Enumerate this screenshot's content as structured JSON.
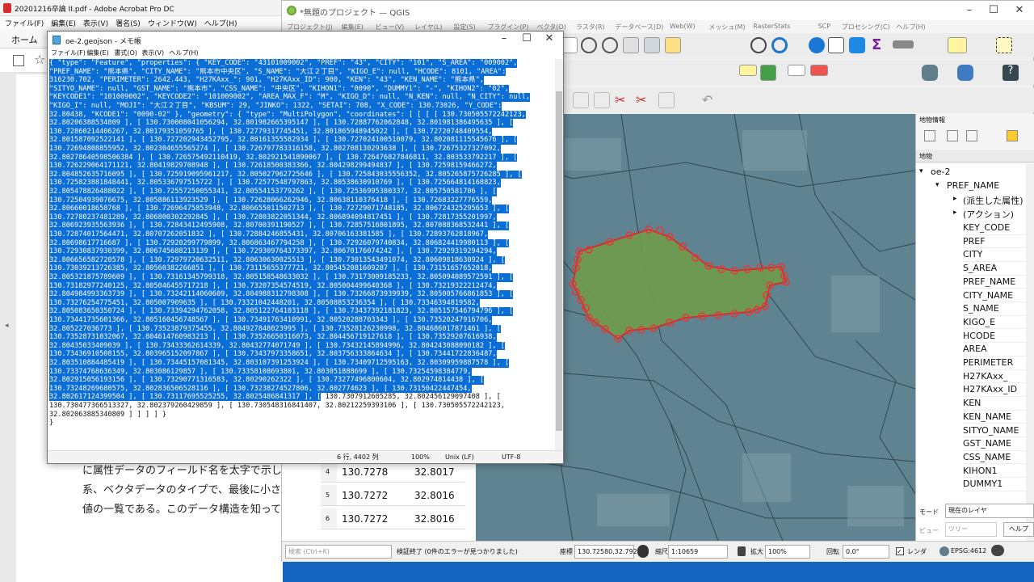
{
  "acrobat": {
    "title": "20201216卒論 II.pdf - Adobe Acrobat Pro DC",
    "menu": "ファイル(F)　編集(E)　表示(V)　署名(S)　ウィンドウ(W)　ヘルプ(H)",
    "home_tab": "ホーム",
    "text_lines": [
      "に属性データのフィールド名を太字で示した。",
      "系、ベクタデータのタイプで、最後に小さい字",
      "値の一覧である。このデータ構造を知っていれ"
    ]
  },
  "qgis": {
    "title": "*無題のプロジェクト — QGIS",
    "menu": [
      "プロジェクト(J)",
      "編集(E)",
      "ビュー(V)",
      "レイヤ(L)",
      "設定(S)",
      "プラグイン(P)",
      "ベクタ(O)",
      "ラスタ(R)",
      "データベース(D)",
      "Web(W)",
      "メッシュ(M)",
      "RasterStats",
      "SCP",
      "プロセシング(C)",
      "ヘルプ(H)"
    ],
    "identify": {
      "title": "地物情報",
      "layer_header": "地物",
      "layer": "oe-2",
      "field": "PREF_NAME",
      "derived": "(派生した属性)",
      "action": "(アクション)",
      "fields": [
        "KEY_CODE",
        "PREF",
        "CITY",
        "S_AREA",
        "PREF_NAME",
        "CITY_NAME",
        "S_NAME",
        "KIGO_E",
        "HCODE",
        "AREA",
        "PERIMETER",
        "H27KAxx_",
        "H27KAxx_ID",
        "KEN",
        "KEN_NAME",
        "SITYO_NAME",
        "GST_NAME",
        "CSS_NAME",
        "KIHON1",
        "DUMMY1"
      ],
      "mode_label": "モード",
      "mode_value": "現在のレイヤ",
      "view_label": "ビュー",
      "view_value": "ツリー",
      "help": "ヘルプ"
    },
    "status": {
      "search_placeholder": "検索 (Ctrl+K)",
      "message": "検証終了 (0件のエラーが見つかりました)",
      "coord_label": "座標",
      "coord": "130.72580,32.79299",
      "scale_label": "縮尺",
      "scale": "1:10659",
      "zoom_label": "拡大",
      "zoom": "100%",
      "rotation_label": "回転",
      "rotation": "0.0°",
      "render": "レンダ",
      "crs": "EPSG:4612"
    },
    "attr_rows": [
      {
        "n": "4",
        "x": "130.7278",
        "y": "32.8017"
      },
      {
        "n": "5",
        "x": "130.7272",
        "y": "32.8016"
      },
      {
        "n": "6",
        "x": "130.7272",
        "y": "32.8016"
      }
    ]
  },
  "notepad": {
    "title": "oe-2.geojson - メモ帳",
    "menu": [
      "ファイル(F)",
      "編集(E)",
      "書式(O)",
      "表示(V)",
      "ヘルプ(H)"
    ],
    "lines": [
      "{ \"type\": \"Feature\", \"properties\": { \"KEY_CODE\": \"43101009002\", \"PREF\": \"43\", \"CITY\": \"101\", \"S_AREA\": \"009002\",",
      "\"PREF_NAME\": \"熊本県\", \"CITY_NAME\": \"熊本市中央区\", \"S_NAME\": \"大江２丁目\", \"KIGO_E\": null, \"HCODE\": 8101, \"AREA\":",
      "316230.702, \"PERIMETER\": 2642.443, \"H27KAxx_\": 901, \"H27KAxx_ID\": 900, \"KEN\": \"43\", \"KEN_NAME\": \"熊本県\",",
      "\"SITYO_NAME\": null, \"GST_NAME\": \"熊本市\", \"CSS_NAME\": \"中央区\", \"KIHON1\": \"0090\", \"DUMMY1\": \"-\", \"KIHON2\": \"02\",",
      "\"KEYCODE1\": \"101009002\", \"KEYCODE2\": \"101009002\", \"AREA_MAX_F\": \"M\", \"KIGO_D\": null, \"N_KEN\": null, \"N_CITY\": null,",
      "\"KIGO_I\": null, \"MOJI\": \"大江２丁目\", \"KBSUM\": 29, \"JINKO\": 1322, \"SETAI\": 708, \"X_CODE\": 130.73026, \"Y_CODE\":",
      "32.80438, \"KCODE1\": \"0090-02\" }, \"geometry\": { \"type\": \"MultiPolygon\", \"coordinates\": [ [ [ [ 130.730505572242123,",
      "32.80206388534809 ], [ 130.730008041056294, 32.801982665395147 ], [ 130.72887762062848, 32.801981386495635 ], [",
      "130.72860214406267, 32.80179351059765 ], [ 130.72779317745451, 32.801865948945022 ], [ 130.72720748409554,",
      "32.801587092522141 ], [ 130.727202943452795, 32.80161355582934 ], [ 130.727024100510079, 32.802081115545676 ], [",
      "130.72694808855952, 32.802304655565274 ], [ 130.726797783316158, 32.802708130293638 ], [ 130.72675327327092,",
      "32.80278640598506384 ], [ 130.726575492110419, 32.802921541890067 ], [ 130.726476827846811, 32.803533792217 ], [",
      "130.726229064171121, 32.80419829708948 ], [ 130.72618500383366, 32.804298299494837 ], [ 130.72598159466272,",
      "32.804852635716095 ], [ 130.725919095961217, 32.805027962725646 ], [ 130.725843035556352, 32.805265875726285 ], [",
      "130.725823881848441, 32.805336797515722 ], [ 130.72577548797863, 32.80538630910769 ], [ 130.725664814168823,",
      "32.805478826488022 ], [ 130.72557250055341, 32.80554153779262 ], [ 130.72536995380337, 32.805750581706 ], [",
      "130.72504939076675, 32.805886113923529 ], [ 130.72628066262946, 32.80638110376418 ], [ 130.72683227776559,",
      "32.80660018658768 ], [ 130.72696475853948, 32.806655011502713 ], [ 130.72729071748185, 32.806724325295653 ], [",
      "130.72780237481289, 32.806800302292845 ], [ 130.72803822051344, 32.806894094817451 ], [ 130.72817355201997,",
      "32.806923935563936 ], [ 130.72843412495908, 32.80700391190527 ], [ 130.72857516801895, 32.807088368532441 ], [",
      "130.72874017564471, 32.80707262051832 ], [ 130.72884246855431, 32.80706163381585 ], [ 130.72893762818967,",
      "32.80698617716687 ], [ 130.72920299779899, 32.806863467794258 ], [ 130.72926079740834, 32.806824419980113 ], [",
      "130.72930837930399, 32.806745688213139 ], [ 130.729309764373397, 32.80670176074242 ], [ 130.72929319294294,",
      "32.806656582720578 ], [ 130.72979720632511, 32.80630630025513 ], [ 130.73013543491074, 32.80609818630924 ], [",
      "130.73039213726385, 32.80560382266851 ], [ 130.73115655377721, 32.805452081609287 ], [ 130.73151657652018,",
      "32.805321875789609 ], [ 130.73161345799318, 32.805158548633032 ], [ 130.73173009185233, 32.805094089572591 ], [",
      "130.73182977240125, 32.805046455717218 ], [ 130.73207354574519, 32.805004499640368 ], [ 130.73219322212474,",
      "32.804984993363739 ], [ 130.73242114060609, 32.804988312798308 ], [ 130.73266873939939, 32.805005766861853 ], [",
      "130.73276254775451, 32.805007909635 ], [ 130.73321042448201, 32.80508853236354 ], [ 130.73346394819582,",
      "32.805083650350724 ], [ 130.73394294762058, 32.805122764103118 ], [ 130.73437392181823, 32.805157546794796 ], [",
      "130.73441735601366, 32.805160456748567 ], [ 130.73491763410991, 32.80520288703343 ], [ 130.73520247916706,",
      "32.805227036773 ], [ 130.73523879375455, 32.804927848023995 ], [ 130.73528126230998, 32.804686017871461 ], [",
      "130.73528731032067, 32.804614760983213 ], [ 130.73526650316073, 32.804456719127618 ], [ 130.73529207616938,",
      "32.80435033409039 ], [ 130.73433362614339, 32.80432774071749 ], [ 130.73432145894996, 32.804243088090182 ], [",
      "130.73436910508155, 32.803965152097867 ], [ 130.73437973358651, 32.803756333864634 ], [ 130.73441722836487,",
      "32.803510884485419 ], [ 130.73445157081345, 32.803107391253924 ], [ 130.73409712595163, 32.80309959887578 ], [",
      "130.73374768636349, 32.803086129857 ], [ 130.73358108693801, 32.803051888699 ], [ 130.73254598384779,",
      "32.802915056193156 ], [ 130.73290771316583, 32.80290262322 ], [ 130.73277496800604, 32.802974814438 ], [",
      "130.73248269680575, 32.802836506528116 ], [ 130.73238274527806, 32.802774623 ], [ 130.73150422447454,"
    ],
    "sel_tail": "32.802617124399504 ], [ 130.73117695525255, 32.8025486841317 ], [",
    "tail": " 130.7307912605285, 32.802456129097408 ], [",
    "plain_lines": [
      "130.730477366513327, 32.802379260429859 ], [ 130.730548316841407, 32.80212259393106 ], [ 130.730505572242123,",
      "32.802063885340809 ] ] ] ] }",
      "}"
    ],
    "status": {
      "pos": "6 行, 4402 列",
      "zoom": "100%",
      "eol": "Unix (LF)",
      "enc": "UTF-8"
    }
  }
}
